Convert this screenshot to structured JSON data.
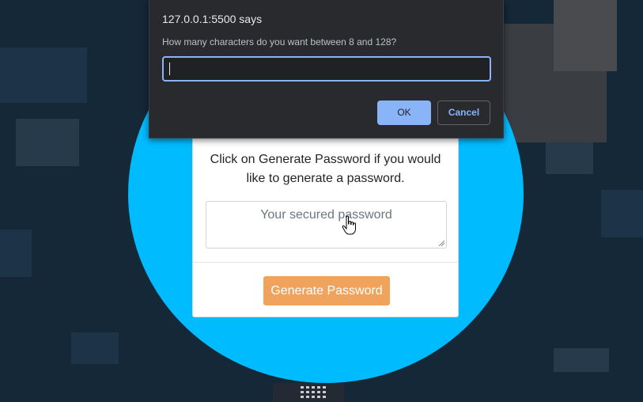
{
  "dialog": {
    "title": "127.0.0.1:5500 says",
    "message": "How many characters do you want between 8 and 128?",
    "input_value": "",
    "ok_label": "OK",
    "cancel_label": "Cancel"
  },
  "card": {
    "instruction": "Click on Generate Password if you would like to generate a password.",
    "password_placeholder": "Your secured password",
    "generate_label": "Generate Password"
  },
  "colors": {
    "accent_circle": "#00bcff",
    "generate_button": "#f0a35c",
    "dialog_ok": "#8ab4f8",
    "dialog_bg": "#292a2d"
  },
  "icons": {
    "cursor": "hand-pointer-icon",
    "resize": "resize-grip-icon"
  }
}
